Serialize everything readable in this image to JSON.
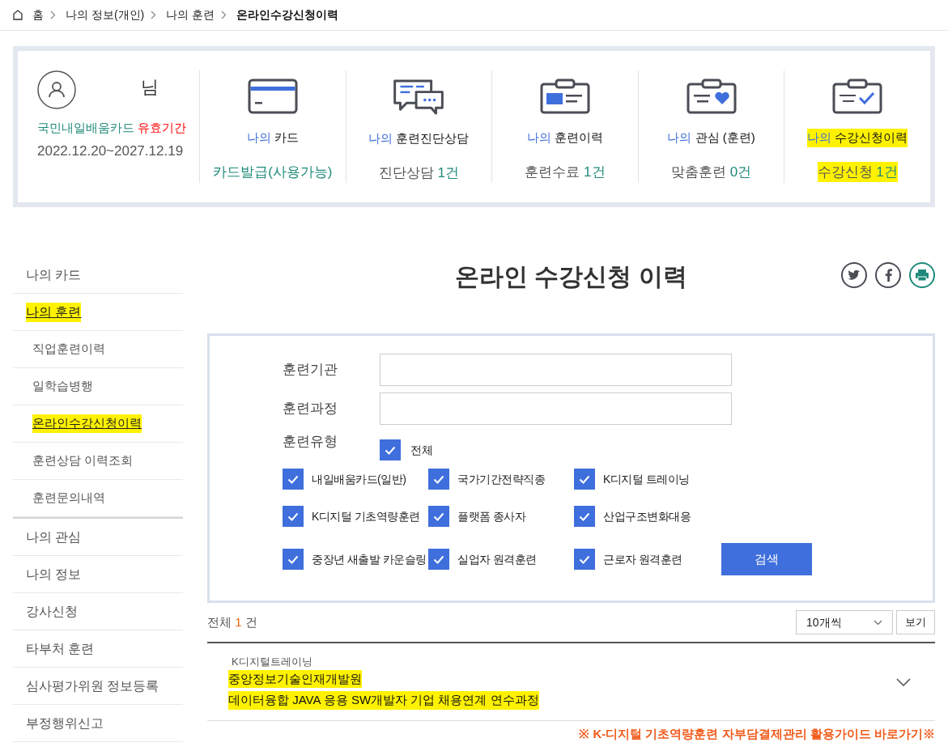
{
  "breadcrumb": [
    "홈",
    "나의 정보(개인)",
    "나의 훈련",
    "온라인수강신청이력"
  ],
  "profile": {
    "suffix": "님",
    "card_name": "국민내일배움카드",
    "validity_label": "유효기간",
    "period": "2022.12.20~2027.12.19"
  },
  "summary": [
    {
      "kind": "card",
      "prefix": "나의",
      "label": "카드",
      "value_count": "카드발급(사용가능)",
      "highlighted": false
    },
    {
      "kind": "chat",
      "prefix": "나의",
      "label": "훈련진단상담",
      "value_label": "진단상담",
      "value_count": "1건",
      "highlighted": false
    },
    {
      "kind": "history",
      "prefix": "나의",
      "label": "훈련이력",
      "value_label": "훈련수료",
      "value_count": "1건",
      "highlighted": false
    },
    {
      "kind": "heart",
      "prefix": "나의",
      "label": "관심 (훈련)",
      "value_label": "맞춤훈련",
      "value_count": "0건",
      "highlighted": false
    },
    {
      "kind": "check",
      "prefix": "나의",
      "label": "수강신청이력",
      "value_label": "수강신청",
      "value_count": "1건",
      "highlighted": true
    }
  ],
  "sidebar": [
    {
      "label": "나의 카드",
      "selected": false,
      "highlighted": false
    },
    {
      "label": "나의 훈련",
      "selected": true,
      "highlighted": true,
      "children": [
        {
          "label": "직업훈련이력",
          "selected": false,
          "highlighted": false
        },
        {
          "label": "일학습병행",
          "selected": false,
          "highlighted": false
        },
        {
          "label": "온라인수강신청이력",
          "selected": true,
          "highlighted": true
        },
        {
          "label": "훈련상담 이력조회",
          "selected": false,
          "highlighted": false
        },
        {
          "label": "훈련문의내역",
          "selected": false,
          "highlighted": false
        }
      ]
    },
    {
      "label": "나의 관심",
      "selected": false,
      "highlighted": false
    },
    {
      "label": "나의 정보",
      "selected": false,
      "highlighted": false
    },
    {
      "label": "강사신청",
      "selected": false,
      "highlighted": false
    },
    {
      "label": "타부처 훈련",
      "selected": false,
      "highlighted": false
    },
    {
      "label": "심사평가위원 정보등록",
      "selected": false,
      "highlighted": false
    },
    {
      "label": "부정행위신고",
      "selected": false,
      "highlighted": false
    }
  ],
  "page_title": "온라인 수강신청 이력",
  "search_form": {
    "fields": [
      {
        "label": "훈련기관"
      },
      {
        "label": "훈련과정"
      }
    ],
    "type_label": "훈련유형",
    "all_option": {
      "label": "전체",
      "checked": true
    },
    "options": [
      {
        "label": "내일배움카드(일반)",
        "checked": true
      },
      {
        "label": "국가기간전략직종",
        "checked": true
      },
      {
        "label": "K디지털 트레이닝",
        "checked": true
      },
      {
        "label": "K디지털 기초역량훈련",
        "checked": true
      },
      {
        "label": "플랫폼 종사자",
        "checked": true
      },
      {
        "label": "산업구조변화대응",
        "checked": true
      },
      {
        "label": "중장년 새출발 카운슬링",
        "checked": true
      },
      {
        "label": "실업자 원격훈련",
        "checked": true
      },
      {
        "label": "근로자 원격훈련",
        "checked": true
      }
    ],
    "search_button": "검색"
  },
  "results": {
    "total_prefix": "전체",
    "total_count": "1",
    "total_suffix": "건",
    "page_size": "10개씩",
    "view_button": "보기",
    "rows": [
      {
        "category": "K디지털트레이닝",
        "institution": "중앙정보기술인재개발원",
        "course": "데이터융합 JAVA 응용 SW개발자 기업 채용연계 연수과정",
        "highlighted": true
      }
    ]
  },
  "guide_link": "※ K-디지털 기초역량훈련 자부담결제관리 활용가이드 바로가기※"
}
